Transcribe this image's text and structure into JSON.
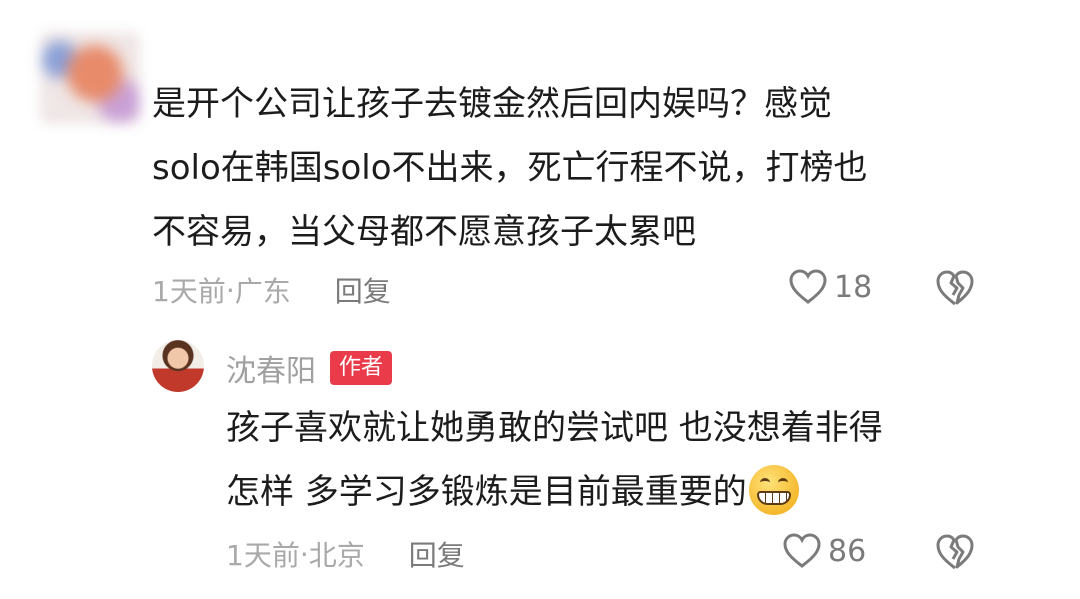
{
  "comment": {
    "text": "是开个公司让孩子去镀金然后回内娱吗？感觉\nsolo在韩国solo不出来，死亡行程不说，打榜也\n不容易，当父母都不愿意孩子太累吧",
    "time": "1天前",
    "separator": " · ",
    "location": "广东",
    "reply_label": "回复",
    "likes": "18",
    "icons": [
      "heart-outline-icon",
      "broken-heart-icon"
    ]
  },
  "reply": {
    "author": "沈春阳",
    "badge": "作者",
    "text": "孩子喜欢就让她勇敢的尝试吧 也没想着非得\n怎样 多学习多锻炼是目前最重要的",
    "emoji": "grinning-face-emoji",
    "time": "1天前",
    "separator": " · ",
    "location": "北京",
    "reply_label": "回复",
    "likes": "86",
    "icons": [
      "heart-outline-icon",
      "broken-heart-icon"
    ]
  },
  "colors": {
    "badge": "#ea3b4a",
    "meta": "#a9a9a9",
    "text": "#1c1c1c"
  }
}
